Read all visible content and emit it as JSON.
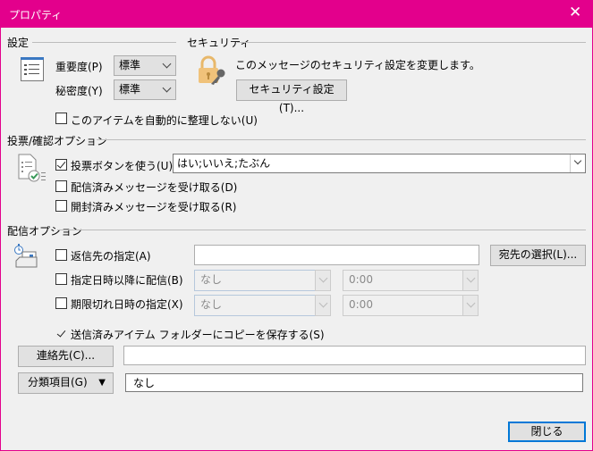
{
  "window": {
    "title": "プロパティ",
    "close_icon": "close-icon",
    "accent": "#e3008c"
  },
  "settings": {
    "header": "設定",
    "importance_label": "重要度(P)",
    "importance_value": "標準",
    "sensitivity_label": "秘密度(Y)",
    "sensitivity_value": "標準",
    "no_autoarchive_label": "このアイテムを自動的に整理しない(U)",
    "no_autoarchive_checked": false
  },
  "security": {
    "header": "セキュリティ",
    "description": "このメッセージのセキュリティ設定を変更します。",
    "button": "セキュリティ設定(T)..."
  },
  "voting": {
    "header": "投票/確認オプション",
    "use_voting_label": "投票ボタンを使う(U)",
    "use_voting_checked": true,
    "voting_value": "はい;いいえ;たぶん",
    "delivery_receipt_label": "配信済みメッセージを受け取る(D)",
    "delivery_receipt_checked": false,
    "read_receipt_label": "開封済みメッセージを受け取る(R)",
    "read_receipt_checked": false
  },
  "delivery": {
    "header": "配信オプション",
    "reply_to_label": "返信先の指定(A)",
    "reply_to_value": "",
    "select_names_button": "宛先の選択(L)...",
    "defer_label": "指定日時以降に配信(B)",
    "defer_date": "なし",
    "defer_time": "0:00",
    "expire_label": "期限切れ日時の指定(X)",
    "expire_date": "なし",
    "expire_time": "0:00",
    "save_copy_label": "送信済みアイテム フォルダーにコピーを保存する(S)",
    "save_copy_checked": true
  },
  "contacts": {
    "button": "連絡先(C)...",
    "value": ""
  },
  "categories": {
    "button": "分類項目(G)",
    "value": "なし"
  },
  "footer": {
    "close_button": "閉じる"
  }
}
